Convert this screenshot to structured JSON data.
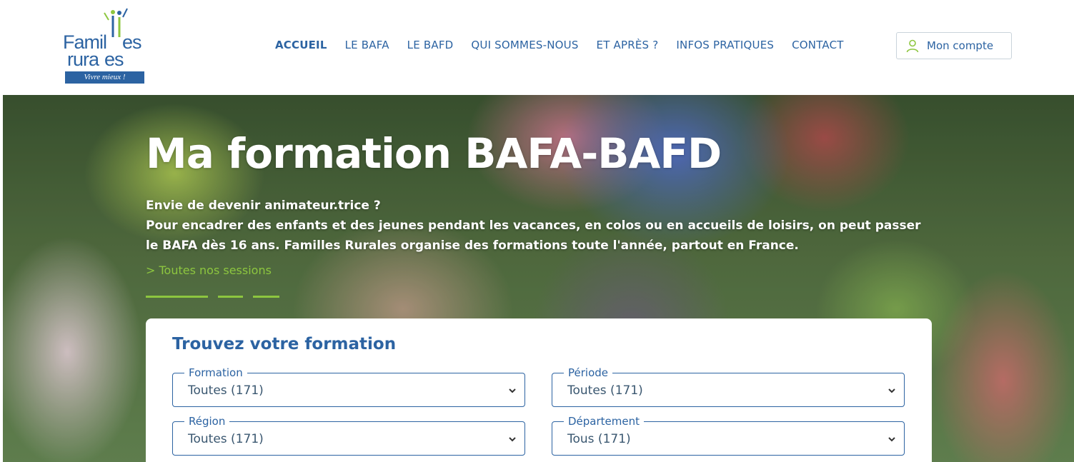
{
  "header": {
    "logo": {
      "line1": "Famil",
      "line1b": "es",
      "line2": "rura",
      "line2b": "es",
      "tagline": "Vivre mieux !"
    },
    "nav": [
      {
        "label": "ACCUEIL",
        "active": true
      },
      {
        "label": "LE BAFA",
        "active": false
      },
      {
        "label": "LE BAFD",
        "active": false
      },
      {
        "label": "QUI SOMMES-NOUS",
        "active": false
      },
      {
        "label": "ET APRÈS ?",
        "active": false
      },
      {
        "label": "INFOS PRATIQUES",
        "active": false
      },
      {
        "label": "CONTACT",
        "active": false
      }
    ],
    "account": {
      "label": "Mon compte",
      "icon": "user-icon"
    }
  },
  "hero": {
    "title": "Ma formation BAFA-BAFD",
    "intro_line1": "Envie de devenir animateur.trice ?",
    "intro_line2": "Pour encadrer des enfants et des jeunes pendant les vacances, en colos ou en accueils de loisirs, on peut passer le BAFA dès 16 ans. Familles Rurales organise des formations toute l'année, partout en France.",
    "link": "> Toutes nos sessions"
  },
  "search": {
    "title": "Trouvez votre formation",
    "fields": [
      {
        "label": "Formation",
        "value": "Toutes (171)"
      },
      {
        "label": "Période",
        "value": "Toutes (171)"
      },
      {
        "label": "Région",
        "value": "Toutes (171)"
      },
      {
        "label": "Département",
        "value": "Tous (171)"
      }
    ]
  },
  "colors": {
    "brand_blue": "#2c63a2",
    "accent_green": "#8dc63f"
  }
}
